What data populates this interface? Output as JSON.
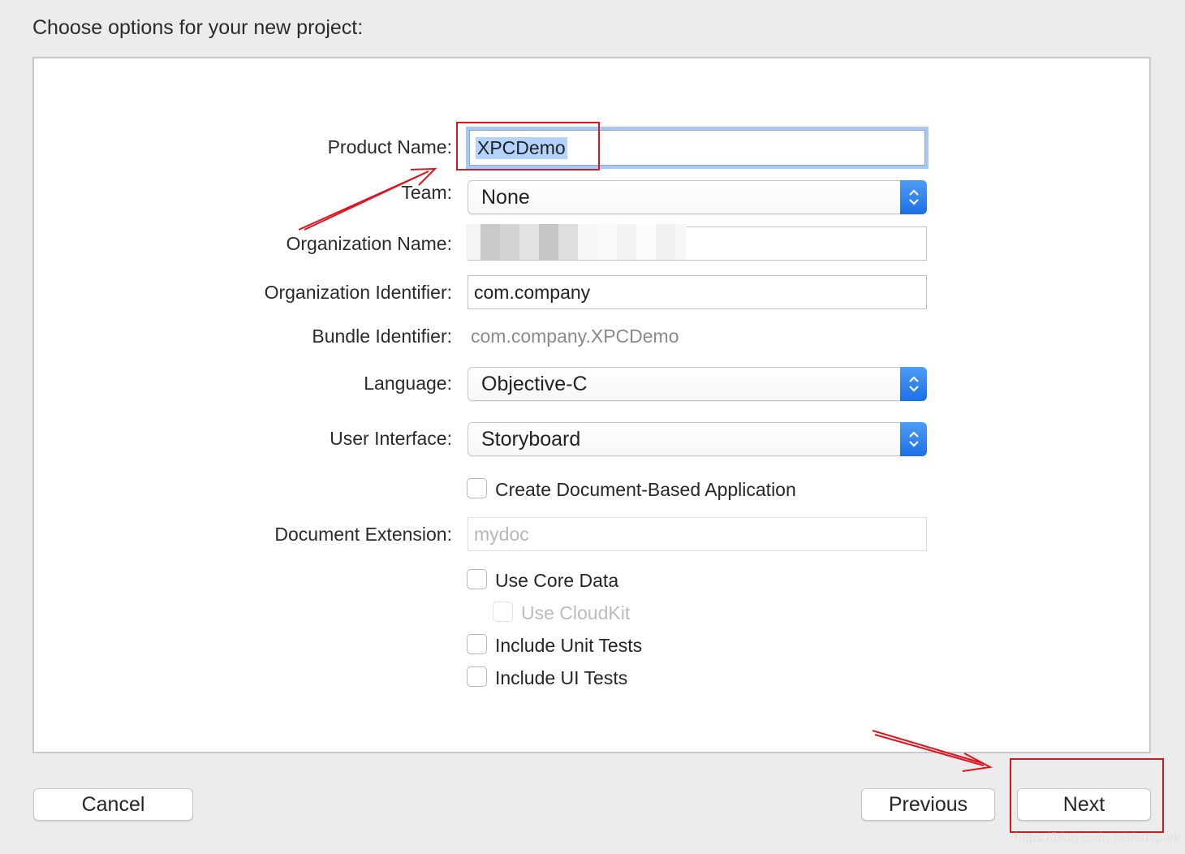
{
  "header": {
    "title": "Choose options for your new project:"
  },
  "form": {
    "product_name": {
      "label": "Product Name:",
      "value": "XPCDemo"
    },
    "team": {
      "label": "Team:",
      "value": "None"
    },
    "organization_name": {
      "label": "Organization Name:",
      "value": ""
    },
    "organization_identifier": {
      "label": "Organization Identifier:",
      "value": "com.company"
    },
    "bundle_identifier": {
      "label": "Bundle Identifier:",
      "value": "com.company.XPCDemo"
    },
    "language": {
      "label": "Language:",
      "value": "Objective-C"
    },
    "user_interface": {
      "label": "User Interface:",
      "value": "Storyboard"
    },
    "document_based": {
      "label": "Create Document-Based Application",
      "checked": false
    },
    "document_extension": {
      "label": "Document Extension:",
      "placeholder": "mydoc"
    },
    "use_core_data": {
      "label": "Use Core Data",
      "checked": false
    },
    "use_cloudkit": {
      "label": "Use CloudKit",
      "checked": false
    },
    "include_unit_tests": {
      "label": "Include Unit Tests",
      "checked": false
    },
    "include_ui_tests": {
      "label": "Include UI Tests",
      "checked": false
    }
  },
  "footer": {
    "cancel_label": "Cancel",
    "previous_label": "Previous",
    "next_label": "Next"
  },
  "watermark": "https://blog.csdn.net/auspark",
  "colors": {
    "annotation_red": "#e0141e",
    "focus_ring": "#a8c8f3",
    "selection": "#b3d3fd",
    "stepper_blue": "#1c6fe4"
  }
}
